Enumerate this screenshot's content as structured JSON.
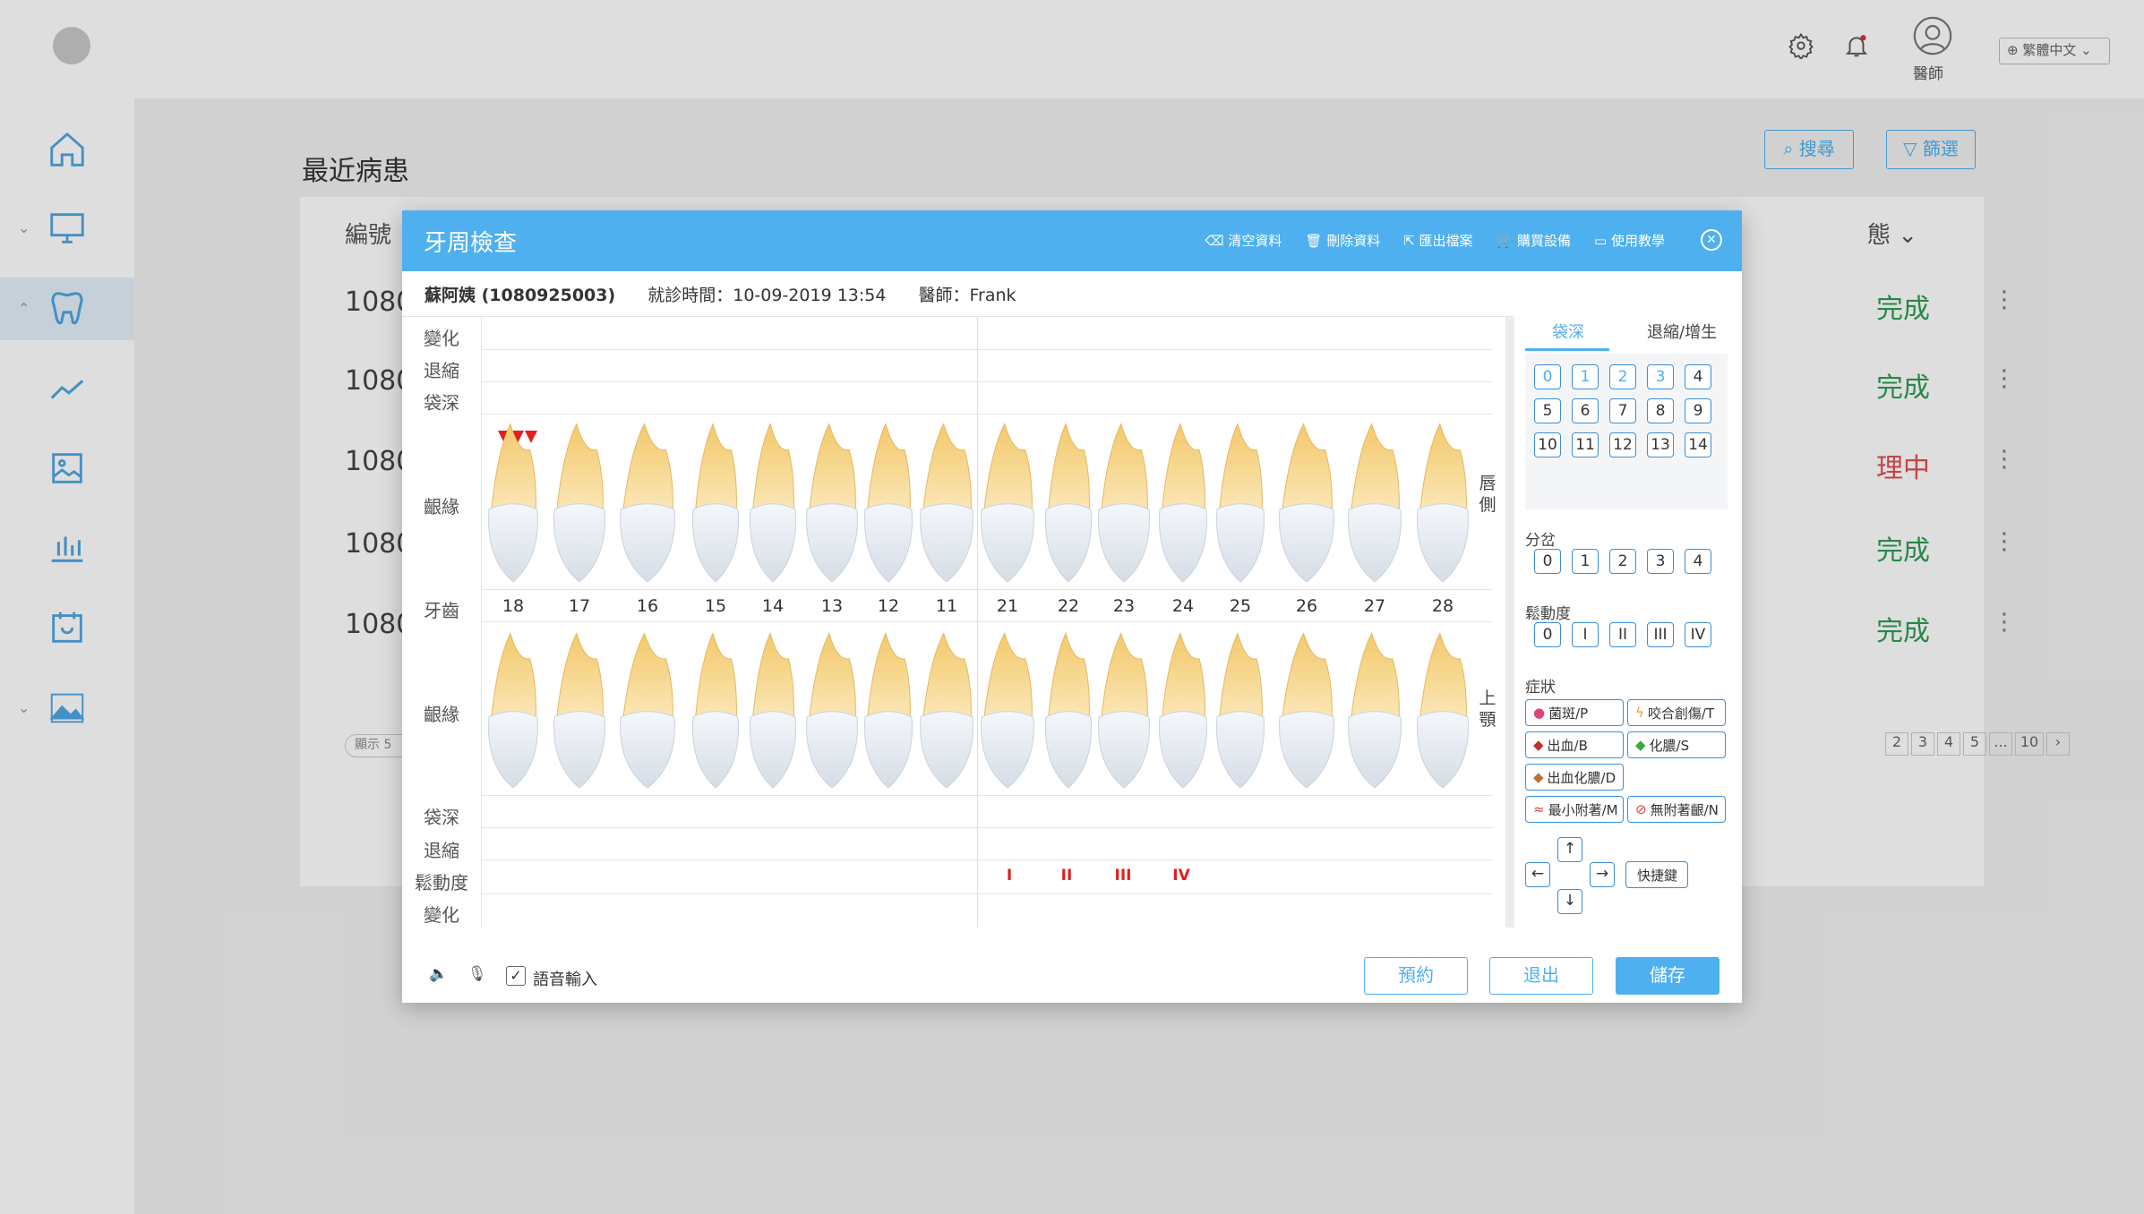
{
  "topbar": {
    "user_label": "醫師",
    "language": "繁體中文"
  },
  "page": {
    "title": "最近病患",
    "search_label": "搜尋",
    "filter_label": "篩選",
    "col_id": "編號",
    "col_status": "態",
    "rows": [
      {
        "id": "1080",
        "status": "完成"
      },
      {
        "id": "1080",
        "status": "完成"
      },
      {
        "id": "1080",
        "status": "理中"
      },
      {
        "id": "1080",
        "status": "完成"
      },
      {
        "id": "1080",
        "status": "完成"
      }
    ],
    "show_count": "顯示 5",
    "pagination": [
      "2",
      "3",
      "4",
      "5",
      "...",
      "10"
    ]
  },
  "modal": {
    "title": "牙周檢查",
    "tools": [
      "清空資料",
      "刪除資料",
      "匯出檔案",
      "購買設備",
      "使用教學"
    ],
    "patient_name": "蘇阿姨 (1080925003)",
    "visit_time": "就診時間：10-09-2019  13:54",
    "doctor": "醫師：Frank",
    "labels": {
      "change": "變化",
      "recession": "退縮",
      "pocket": "袋深",
      "gum": "齦緣",
      "tooth": "牙齒",
      "mobility": "鬆動度",
      "lip_side": "唇側",
      "upper_jaw": "上顎"
    },
    "teeth_left": [
      "18",
      "17",
      "16",
      "15",
      "14",
      "13",
      "12",
      "11"
    ],
    "teeth_right": [
      "21",
      "22",
      "23",
      "24",
      "25",
      "26",
      "27",
      "28"
    ],
    "mobility_marks": [
      "I",
      "II",
      "III",
      "IV"
    ],
    "panel": {
      "tab_pocket": "袋深",
      "tab_recession": "退縮/增生",
      "pocket_values": [
        "0",
        "1",
        "2",
        "3",
        "4",
        "5",
        "6",
        "7",
        "8",
        "9",
        "10",
        "11",
        "12",
        "13",
        "14"
      ],
      "furcation_label": "分岔",
      "furcation_values": [
        "0",
        "1",
        "2",
        "3",
        "4"
      ],
      "mobility_label": "鬆動度",
      "mobility_values": [
        "0",
        "I",
        "II",
        "III",
        "IV"
      ],
      "symptom_label": "症狀",
      "symptoms": [
        "菌斑/P",
        "咬合創傷/T",
        "出血/B",
        "化膿/S",
        "出血化膿/D",
        "最小附著/M",
        "無附著齦/N"
      ],
      "arrows": [
        "↑",
        "←",
        "→",
        "↓"
      ],
      "shortcut": "快捷鍵"
    },
    "footer": {
      "voice_input": "語音輸入",
      "appointment": "預約",
      "exit": "退出",
      "save": "儲存"
    }
  },
  "colors": {
    "accent": "#4fb0ef",
    "danger": "#e02020",
    "status_processing": "#e05050"
  }
}
